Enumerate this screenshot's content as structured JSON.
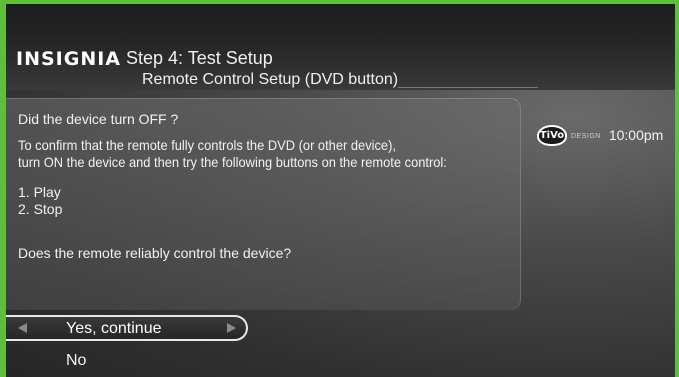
{
  "header": {
    "brand": "INSIGNIA",
    "step_title": "Step 4: Test Setup",
    "subtitle": "Remote Control Setup (DVD button)"
  },
  "status": {
    "logo_text": "TiVo",
    "design_text": "DESIGN",
    "time": "10:00pm"
  },
  "content": {
    "question": "Did the device turn OFF ?",
    "instructions_line1": "To confirm that the remote fully controls the DVD (or other device),",
    "instructions_line2": "turn ON the device and then try the following buttons on the remote control:",
    "steps": [
      "1. Play",
      "2. Stop"
    ],
    "prompt": "Does the remote reliably control the device?"
  },
  "menu": {
    "options": [
      {
        "label": "Yes, continue",
        "selected": true
      },
      {
        "label": "No",
        "selected": false
      }
    ]
  },
  "colors": {
    "frame": "#5fbf3a",
    "background": "#3a3a3a",
    "text": "#f2f2f2"
  }
}
